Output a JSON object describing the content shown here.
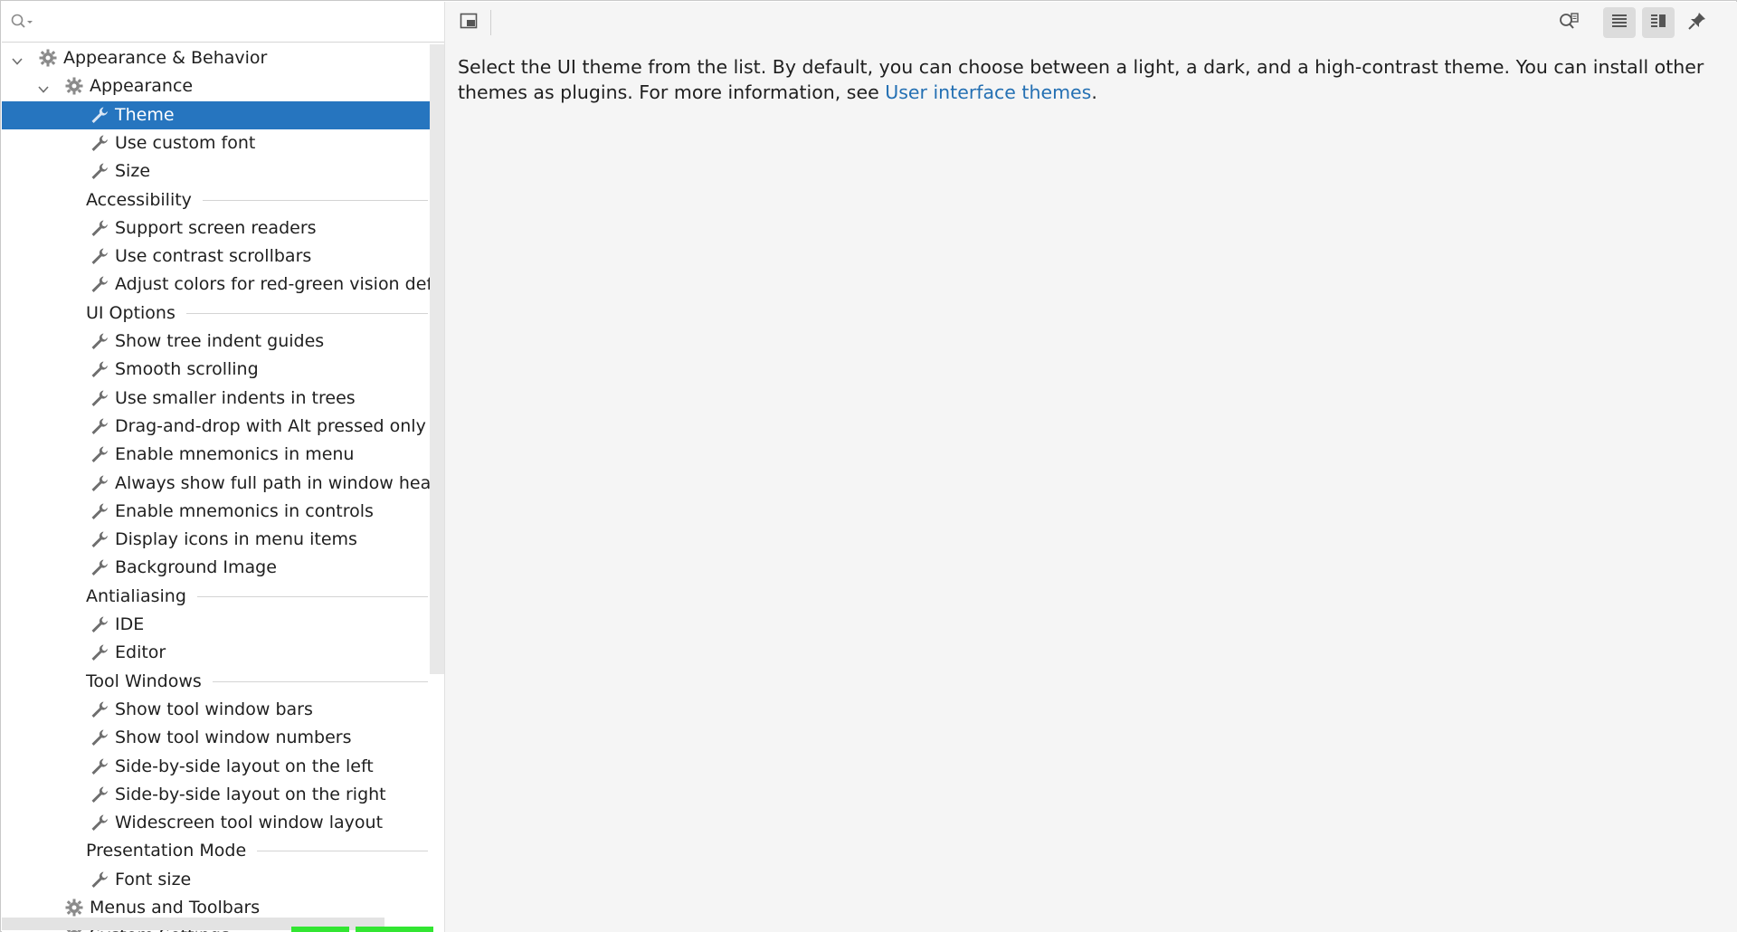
{
  "search": {
    "placeholder": ""
  },
  "tree": {
    "root_label": "Appearance & Behavior",
    "appearance_label": "Appearance",
    "selected_item": "Theme",
    "items_appearance": [
      "Theme",
      "Use custom font",
      "Size"
    ],
    "sections": [
      {
        "title": "Accessibility",
        "items": [
          "Support screen readers",
          "Use contrast scrollbars",
          "Adjust colors for red-green vision deficiency"
        ]
      },
      {
        "title": "UI Options",
        "items": [
          "Show tree indent guides",
          "Smooth scrolling",
          "Use smaller indents in trees",
          "Drag-and-drop with Alt pressed only",
          "Enable mnemonics in menu",
          "Always show full path in window header",
          "Enable mnemonics in controls",
          "Display icons in menu items",
          "Background Image"
        ]
      },
      {
        "title": "Antialiasing",
        "items": [
          "IDE",
          "Editor"
        ]
      },
      {
        "title": "Tool Windows",
        "items": [
          "Show tool window bars",
          "Show tool window numbers",
          "Side-by-side layout on the left",
          "Side-by-side layout on the right",
          "Widescreen tool window layout"
        ]
      },
      {
        "title": "Presentation Mode",
        "items": [
          "Font size"
        ]
      }
    ],
    "menus_toolbars_label": "Menus and Toolbars",
    "next_item_label": "System Settings"
  },
  "toolbar": {
    "preview_icon": "preview-window-icon",
    "find_icon": "find-in-help-icon",
    "list_icon": "list-view-icon",
    "split_icon": "split-view-icon",
    "pin_icon": "pin-icon"
  },
  "content": {
    "description_text": "Select the UI theme from the list. By default, you can choose between a light, a dark, and a high-contrast theme. You can install other themes as plugins. For more information, see ",
    "link_text": "User interface themes",
    "trailing_text": "."
  },
  "colors": {
    "selection": "#2675bf",
    "link": "#2470b3",
    "panel_bg": "#f5f5f5"
  }
}
